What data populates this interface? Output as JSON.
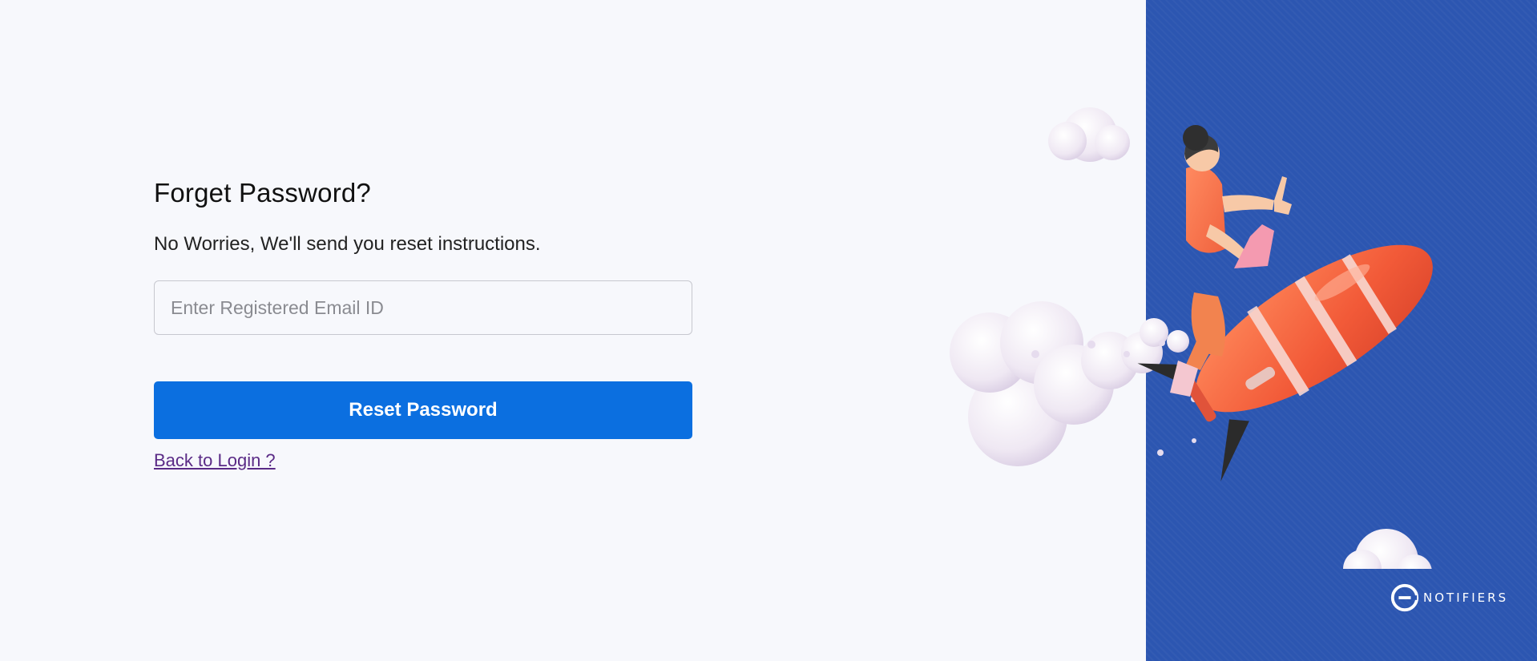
{
  "form": {
    "title": "Forget Password?",
    "subtitle": "No Worries, We'll send you reset instructions.",
    "email_placeholder": "Enter Registered Email ID",
    "email_value": "",
    "submit_label": "Reset Password",
    "back_link_label": "Back to Login ?"
  },
  "brand": {
    "logo_text": "NOTIFIERS",
    "logo_icon": "e-logo-icon"
  },
  "illustration": {
    "icon": "rocket-rider-illustration"
  },
  "colors": {
    "background": "#f7f8fc",
    "panel": "#2c56b1",
    "primary_button": "#0b6fe0",
    "link": "#5a2a86"
  }
}
